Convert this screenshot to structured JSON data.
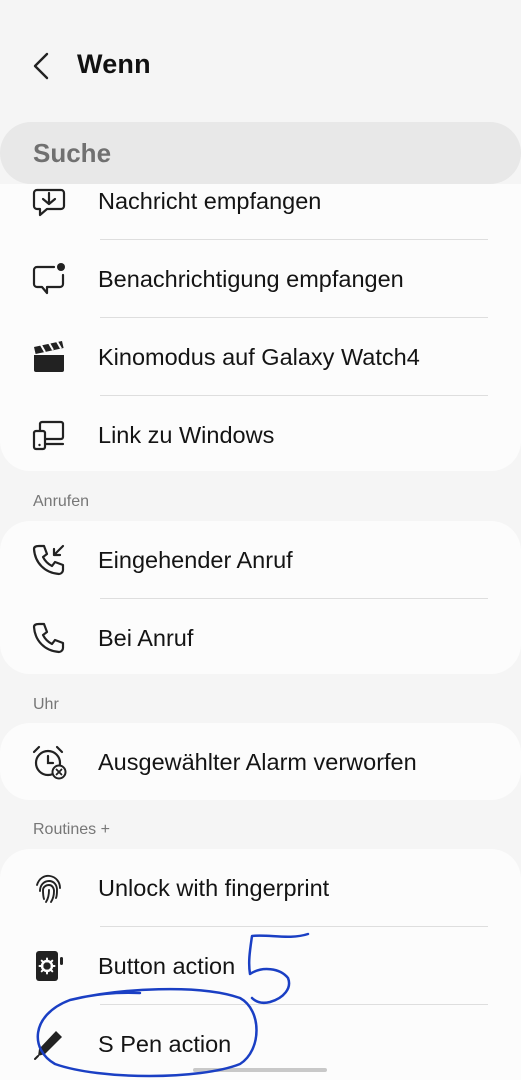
{
  "header": {
    "title": "Wenn",
    "back_icon": "chevron-left-icon"
  },
  "search": {
    "placeholder": "Suche"
  },
  "groups": [
    {
      "items": [
        {
          "label": "Nachricht empfangen",
          "icon": "message-received-icon"
        },
        {
          "label": "Benachrichtigung empfangen",
          "icon": "notification-icon"
        },
        {
          "label": "Kinomodus auf Galaxy Watch4",
          "icon": "clapperboard-icon"
        },
        {
          "label": "Link zu Windows",
          "icon": "link-to-windows-icon"
        }
      ]
    },
    {
      "header": "Anrufen",
      "items": [
        {
          "label": "Eingehender Anruf",
          "icon": "incoming-call-icon"
        },
        {
          "label": "Bei Anruf",
          "icon": "phone-icon"
        }
      ]
    },
    {
      "header": "Uhr",
      "items": [
        {
          "label": "Ausgewählter Alarm verworfen",
          "icon": "alarm-dismissed-icon"
        }
      ]
    },
    {
      "header": "Routines +",
      "items": [
        {
          "label": "Unlock with fingerprint",
          "icon": "fingerprint-icon"
        },
        {
          "label": "Button action",
          "icon": "button-action-icon"
        },
        {
          "label": "S Pen action",
          "icon": "pen-icon"
        }
      ]
    }
  ],
  "annotation": {
    "color": "#1a3fc4",
    "digit": "5"
  }
}
